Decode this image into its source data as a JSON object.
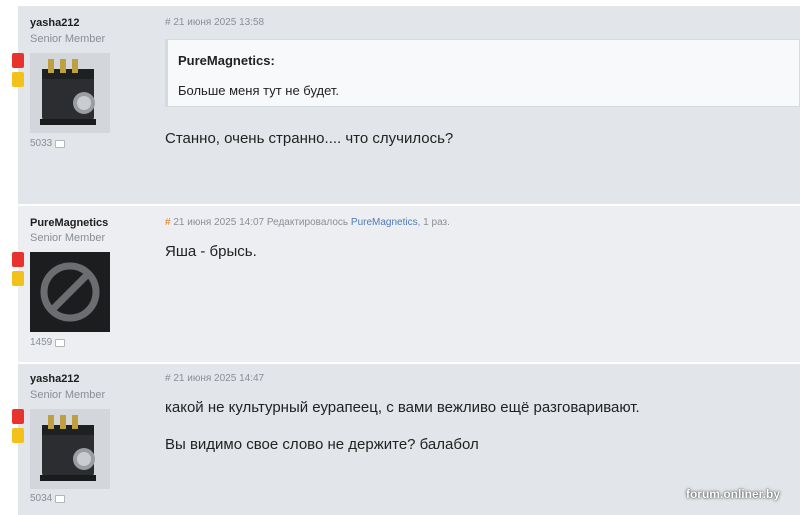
{
  "posts": [
    {
      "username": "yasha212",
      "rank": "Senior Member",
      "post_count": "5033",
      "avatar": "knob-device-photo",
      "hash": "#",
      "timestamp": "21 июня 2025 13:58",
      "quote": {
        "author": "PureMagnetics:",
        "text": "Больше меня тут не будет."
      },
      "message_lines": [
        "Станно, очень странно.... что случилось?"
      ]
    },
    {
      "username": "PureMagnetics",
      "rank": "Senior Member",
      "post_count": "1459",
      "avatar": "banned-circle-icon",
      "hash": "#",
      "timestamp": "21 июня 2025 14:07",
      "edited_prefix": "Редактировалось",
      "edited_by": "PureMagnetics",
      "edited_suffix": ", 1 раз.",
      "message_lines": [
        "Яша - брысь."
      ]
    },
    {
      "username": "yasha212",
      "rank": "Senior Member",
      "post_count": "5034",
      "avatar": "knob-device-photo",
      "hash": "#",
      "timestamp": "21 июня 2025 14:47",
      "message_lines": [
        "какой не культурный еурапеец, с вами вежливо ещё разговаривают.",
        "Вы видимо свое слово не держите? балабол"
      ]
    }
  ],
  "watermark": "forum.onliner.by",
  "colors": {
    "post_bg": "#e2e5e9",
    "post_bg_alt": "#eceef1",
    "flag_red": "#e8322d",
    "flag_yellow": "#f2c21b",
    "link": "#4f7bb8",
    "hash_highlight": "#e07b1f"
  }
}
